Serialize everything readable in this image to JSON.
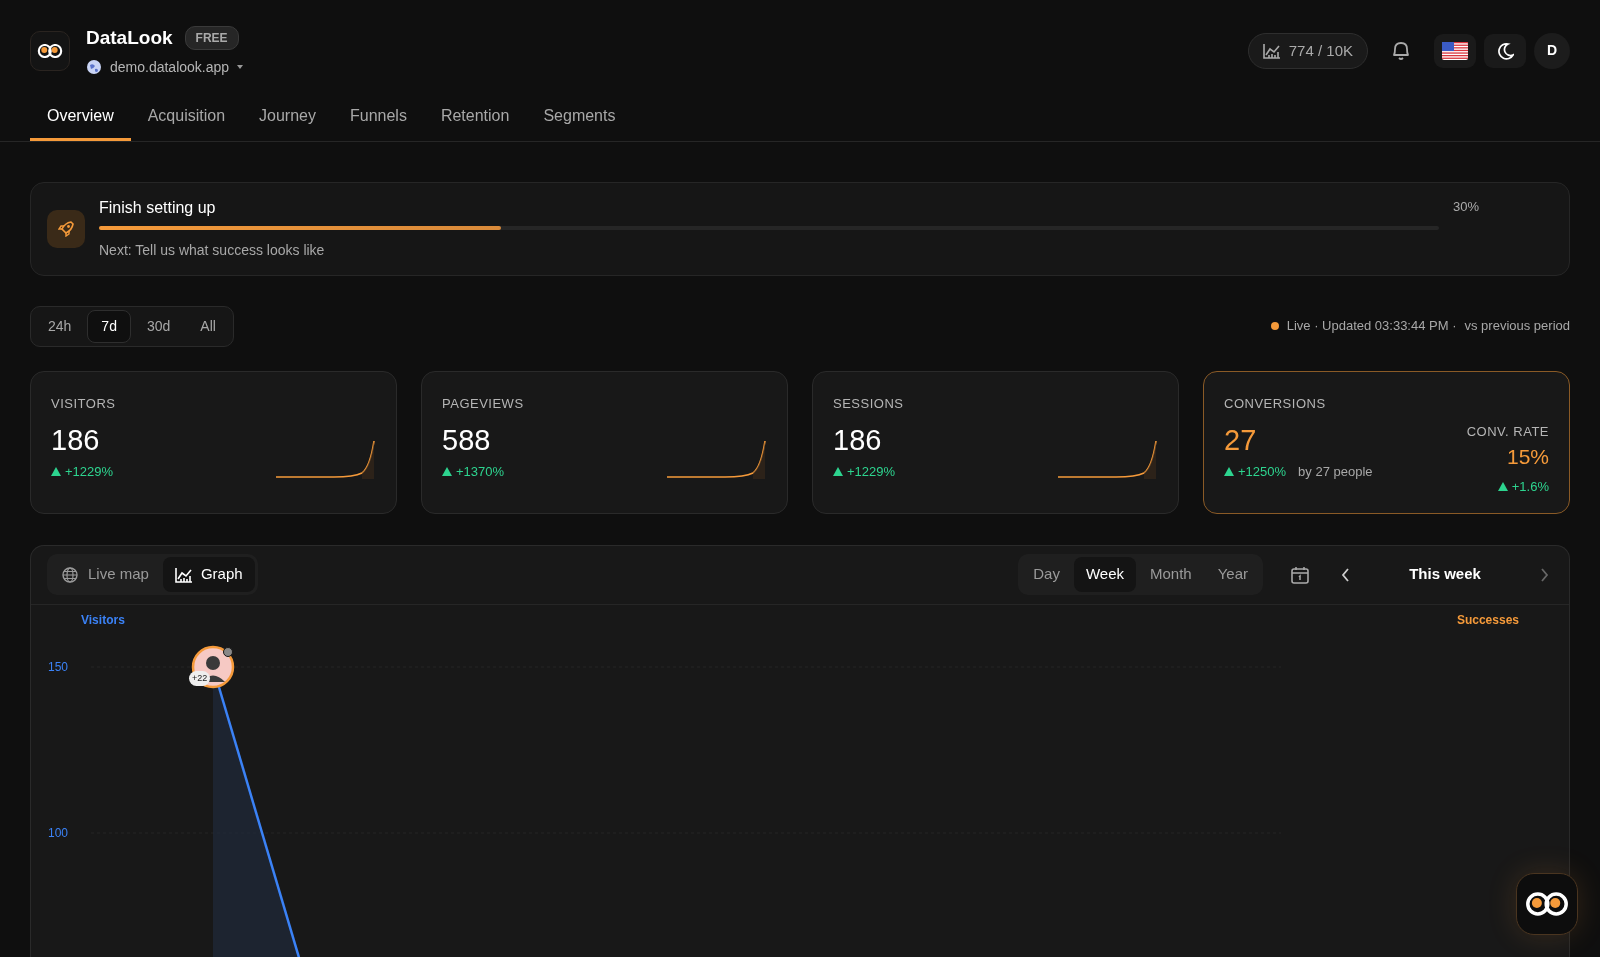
{
  "app": {
    "name": "DataLook",
    "plan": "FREE",
    "site": "demo.datalook.app"
  },
  "usage": {
    "text": "774 / 10K"
  },
  "user_initial": "D",
  "tabs": [
    {
      "label": "Overview",
      "selected": true
    },
    {
      "label": "Acquisition",
      "selected": false
    },
    {
      "label": "Journey",
      "selected": false
    },
    {
      "label": "Funnels",
      "selected": false
    },
    {
      "label": "Retention",
      "selected": false
    },
    {
      "label": "Segments",
      "selected": false
    }
  ],
  "setup": {
    "title": "Finish setting up",
    "next": "Next: Tell us what success looks like",
    "percent": "30%",
    "level": 0.3
  },
  "periods": [
    {
      "label": "24h",
      "selected": false
    },
    {
      "label": "7d",
      "selected": true
    },
    {
      "label": "30d",
      "selected": false
    },
    {
      "label": "All",
      "selected": false
    }
  ],
  "status": {
    "updated": "Live · Updated 03:33:44 PM ·",
    "compare": "vs previous period"
  },
  "metrics": [
    {
      "label": "VISITORS",
      "value": "186",
      "change": "+1229%",
      "highlighted": false
    },
    {
      "label": "PAGEVIEWS",
      "value": "588",
      "change": "+1370%",
      "highlighted": false
    },
    {
      "label": "SESSIONS",
      "value": "186",
      "change": "+1229%",
      "highlighted": false
    },
    {
      "label": "CONVERSIONS",
      "value": "27",
      "change": "+1250%",
      "note": "by 27 people",
      "highlighted": true,
      "rate_label": "CONV. RATE",
      "rate": "15%",
      "rate_change": "+1.6%"
    }
  ],
  "chart_panel": {
    "views": [
      {
        "label": "Live map",
        "kind": "globe",
        "selected": false
      },
      {
        "label": "Graph",
        "kind": "graph",
        "selected": true
      }
    ],
    "ranges": [
      {
        "label": "Day",
        "selected": false
      },
      {
        "label": "Week",
        "selected": true
      },
      {
        "label": "Month",
        "selected": false
      },
      {
        "label": "Year",
        "selected": false
      }
    ],
    "range_label": "This week",
    "left_axis_label": "Visitors",
    "right_axis_label": "Successes",
    "marker_count": "+22",
    "y_ticks": [
      "150",
      "100"
    ]
  }
}
